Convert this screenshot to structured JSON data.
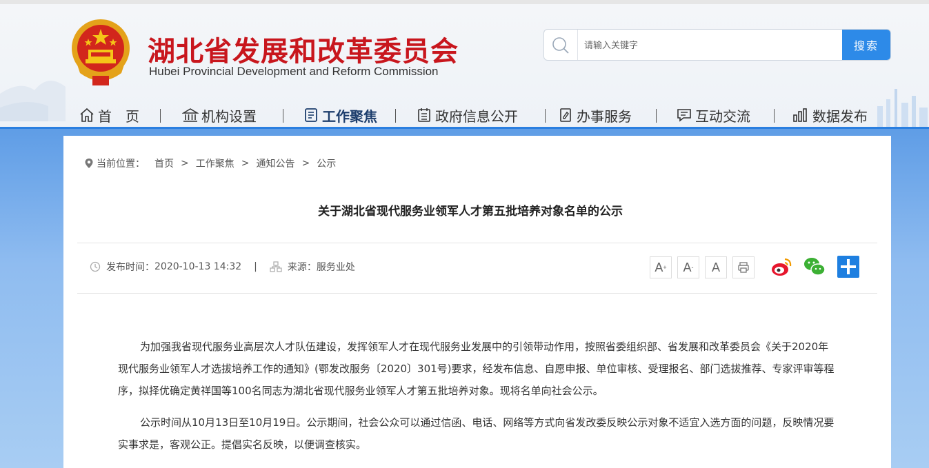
{
  "header": {
    "title": "湖北省发展和改革委员会",
    "subtitle": "Hubei Provincial Development and Reform Commission"
  },
  "search": {
    "placeholder": "请输入关键字",
    "button_label": "搜索"
  },
  "nav": {
    "items": [
      {
        "label": "首　页",
        "icon": "home-icon",
        "active": false
      },
      {
        "label": "机构设置",
        "icon": "institution-icon",
        "active": false
      },
      {
        "label": "工作聚焦",
        "icon": "document-icon",
        "active": true
      },
      {
        "label": "政府信息公开",
        "icon": "calendar-icon",
        "active": false
      },
      {
        "label": "办事服务",
        "icon": "edit-icon",
        "active": false
      },
      {
        "label": "互动交流",
        "icon": "chat-icon",
        "active": false
      },
      {
        "label": "数据发布",
        "icon": "bar-chart-icon",
        "active": false
      }
    ]
  },
  "breadcrumb": {
    "prefix": "当前位置：",
    "items": [
      "首页",
      "工作聚焦",
      "通知公告",
      "公示"
    ],
    "separator": ">"
  },
  "article": {
    "title": "关于湖北省现代服务业领军人才第五批培养对象名单的公示",
    "publish_label": "发布时间：",
    "publish_time": "2020-10-13 14:32",
    "meta_separator": "|",
    "source_label": "来源：",
    "source": "服务业处",
    "paragraphs": [
      "为加强我省现代服务业高层次人才队伍建设，发挥领军人才在现代服务业发展中的引领带动作用，按照省委组织部、省发展和改革委员会《关于2020年现代服务业领军人才选拔培养工作的通知》(鄂发改服务〔2020〕301号)要求，经发布信息、自愿申报、单位审核、受理报名、部门选拔推荐、专家评审等程序，拟择优确定黄祥国等100名同志为湖北省现代服务业领军人才第五批培养对象。现将名单向社会公示。",
      "公示时间从10月13日至10月19日。公示期间，社会公众可以通过信函、电话、网络等方式向省发改委反映公示对象不适宜入选方面的问题，反映情况要实事求是，客观公正。提倡实名反映，以便调查核实。"
    ]
  },
  "tools": {
    "font_large": "A",
    "font_large_sup": "+",
    "font_small": "A",
    "font_small_sup": "-",
    "font_reset": "A"
  },
  "colors": {
    "title_red": "#c8161d",
    "accent_blue": "#2d8ae8",
    "weibo": "#e6162d",
    "wechat": "#3cb034",
    "share_blue": "#1e7fe0"
  }
}
